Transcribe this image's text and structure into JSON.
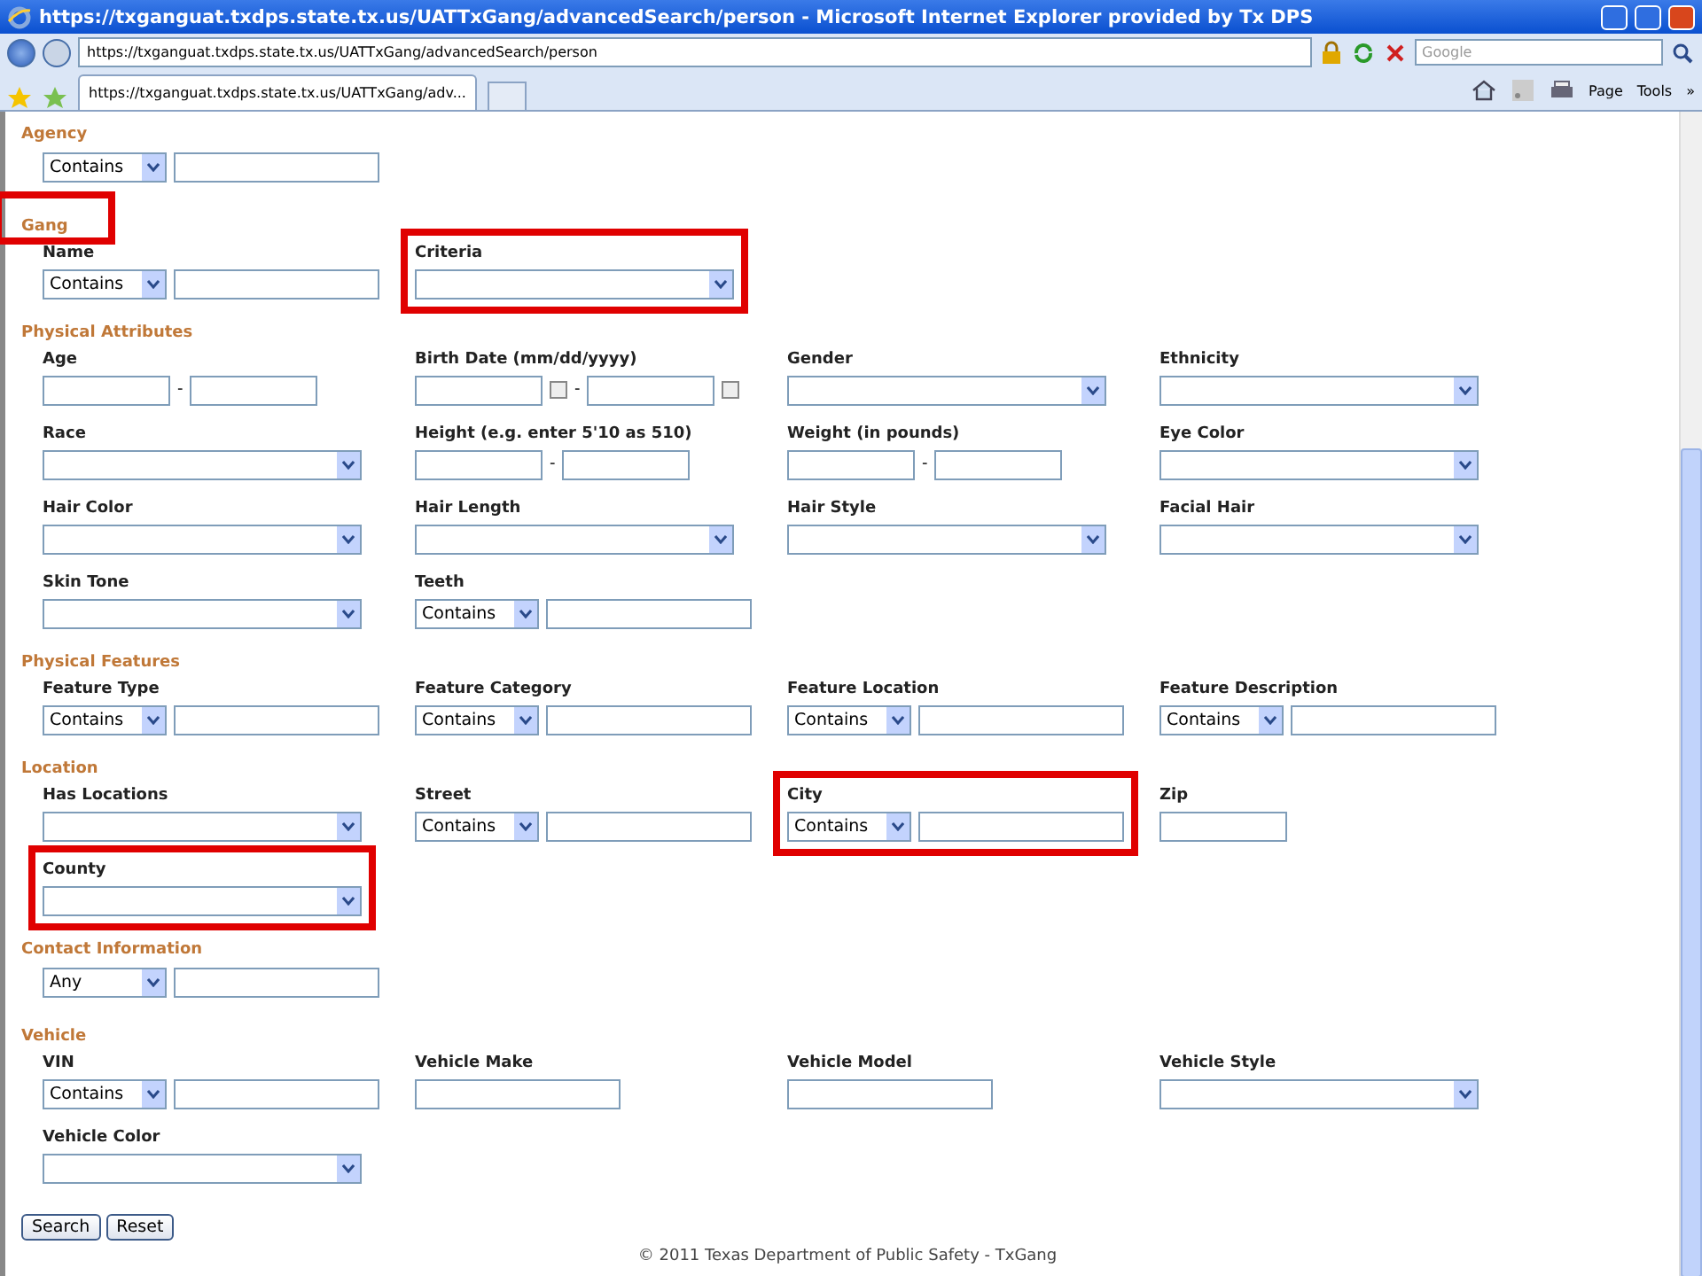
{
  "window": {
    "title": "https://txganguat.txdps.state.tx.us/UATTxGang/advancedSearch/person - Microsoft Internet Explorer provided by Tx DPS"
  },
  "address_bar": {
    "url": "https://txganguat.txdps.state.tx.us/UATTxGang/advancedSearch/person"
  },
  "search": {
    "placeholder": "Google"
  },
  "tabs": [
    {
      "label": "https://txganguat.txdps.state.tx.us/UATTxGang/adv...",
      "selected": true
    }
  ],
  "toolbar": {
    "items": [
      {
        "label": "Page"
      },
      {
        "label": "Tools"
      }
    ],
    "more": "»"
  },
  "sections": [
    {
      "title": "Agency",
      "highlighted": false,
      "fields": [
        {
          "kind": "select_text",
          "option": "Contains",
          "highlighted": false
        }
      ]
    },
    {
      "title": "Gang",
      "highlighted": true,
      "fields": [
        {
          "kind": "select_text",
          "label": "Name",
          "option": "Contains",
          "highlighted": false
        },
        {
          "kind": "select",
          "label": "Criteria",
          "highlighted": true
        }
      ]
    },
    {
      "title": "Physical Attributes",
      "highlighted": false,
      "fields": [
        {
          "kind": "range",
          "label": "Age",
          "separator": "-",
          "highlighted": false
        },
        {
          "kind": "date_range",
          "label": "Birth Date (mm/dd/yyyy)",
          "separator": "-",
          "highlighted": false
        },
        {
          "kind": "select",
          "label": "Gender",
          "highlighted": false
        },
        {
          "kind": "select",
          "label": "Ethnicity",
          "highlighted": false
        },
        {
          "kind": "select",
          "label": "Race",
          "highlighted": false
        },
        {
          "kind": "range",
          "label": "Height (e.g. enter 5'10 as 510)",
          "separator": "-",
          "highlighted": false
        },
        {
          "kind": "range",
          "label": "Weight (in pounds)",
          "separator": "-",
          "highlighted": false
        },
        {
          "kind": "select",
          "label": "Eye Color",
          "highlighted": false
        },
        {
          "kind": "select",
          "label": "Hair Color",
          "highlighted": false
        },
        {
          "kind": "select",
          "label": "Hair Length",
          "highlighted": false
        },
        {
          "kind": "select",
          "label": "Hair Style",
          "highlighted": false
        },
        {
          "kind": "select",
          "label": "Facial Hair",
          "highlighted": false
        },
        {
          "kind": "select",
          "label": "Skin Tone",
          "highlighted": false
        },
        {
          "kind": "select_text",
          "label": "Teeth",
          "option": "Contains",
          "highlighted": false
        }
      ]
    },
    {
      "title": "Physical Features",
      "highlighted": false,
      "fields": [
        {
          "kind": "select_text",
          "label": "Feature Type",
          "option": "Contains",
          "highlighted": false
        },
        {
          "kind": "select_text",
          "label": "Feature Category",
          "option": "Contains",
          "highlighted": false
        },
        {
          "kind": "select_text",
          "label": "Feature Location",
          "option": "Contains",
          "highlighted": false
        },
        {
          "kind": "select_text",
          "label": "Feature Description",
          "option": "Contains",
          "highlighted": false
        }
      ]
    },
    {
      "title": "Location",
      "highlighted": false,
      "fields": [
        {
          "kind": "select",
          "label": "Has Locations",
          "highlighted": false
        },
        {
          "kind": "select_text",
          "label": "Street",
          "option": "Contains",
          "highlighted": false
        },
        {
          "kind": "select_text",
          "label": "City",
          "option": "Contains",
          "highlighted": true
        },
        {
          "kind": "short_text",
          "label": "Zip",
          "highlighted": false
        },
        {
          "kind": "select",
          "label": "County",
          "highlighted": true
        }
      ]
    },
    {
      "title": "Contact Information",
      "highlighted": false,
      "fields": [
        {
          "kind": "select_text",
          "option": "Any",
          "highlighted": false
        }
      ]
    },
    {
      "title": "Vehicle",
      "highlighted": false,
      "fields": [
        {
          "kind": "select_text",
          "label": "VIN",
          "option": "Contains",
          "highlighted": false
        },
        {
          "kind": "text",
          "label": "Vehicle Make",
          "highlighted": false
        },
        {
          "kind": "text",
          "label": "Vehicle Model",
          "highlighted": false
        },
        {
          "kind": "select",
          "label": "Vehicle Style",
          "highlighted": false
        },
        {
          "kind": "select",
          "label": "Vehicle Color",
          "highlighted": false
        }
      ]
    }
  ],
  "buttons": [
    "Search",
    "Reset"
  ],
  "footer": "© 2011 Texas Department of Public Safety - TxGang"
}
